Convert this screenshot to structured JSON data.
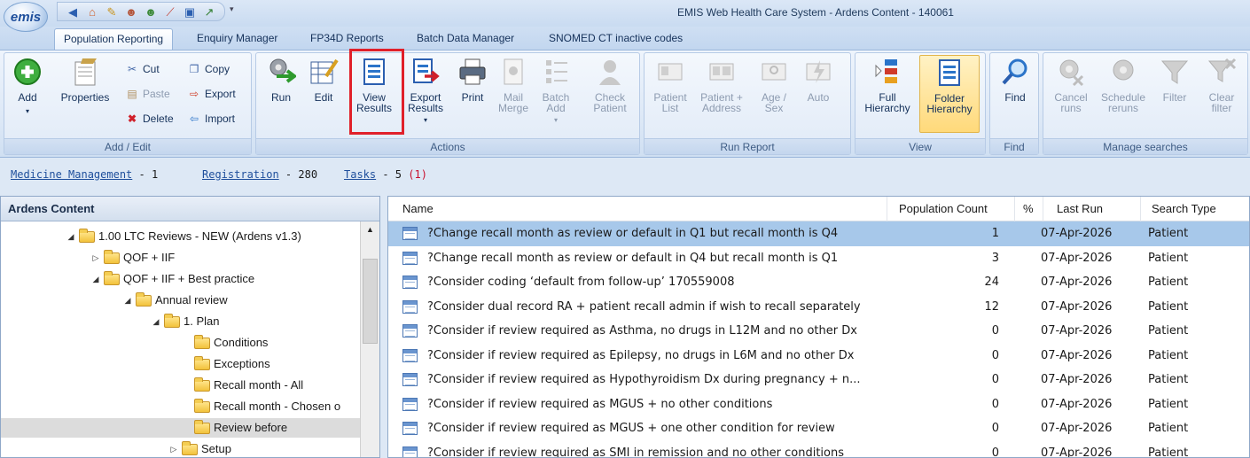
{
  "app": {
    "logo_text": "emis",
    "window_title": "EMIS Web Health Care System - Ardens Content - 140061",
    "quick_access_icons": [
      "back-icon",
      "home-icon",
      "pencil-icon",
      "users-icon",
      "user-group-icon",
      "chart-icon",
      "window-icon",
      "graph-icon"
    ]
  },
  "tabs": [
    "Population Reporting",
    "Enquiry Manager",
    "FP34D Reports",
    "Batch Data Manager",
    "SNOMED CT inactive codes"
  ],
  "ribbon": {
    "add_edit": {
      "label": "Add / Edit",
      "add": "Add",
      "properties": "Properties",
      "cut": "Cut",
      "copy": "Copy",
      "paste": "Paste",
      "export": "Export",
      "delete": "Delete",
      "import": "Import"
    },
    "actions": {
      "label": "Actions",
      "run": "Run",
      "edit": "Edit",
      "view_results": "View\nResults",
      "export_results": "Export\nResults",
      "print": "Print",
      "mail_merge": "Mail\nMerge",
      "batch_add": "Batch\nAdd",
      "check_patient": "Check\nPatient"
    },
    "run_report": {
      "label": "Run Report",
      "patient_list": "Patient\nList",
      "patient_address": "Patient +\nAddress",
      "age_sex": "Age /\nSex",
      "auto": "Auto"
    },
    "view": {
      "label": "View",
      "full_hierarchy": "Full\nHierarchy",
      "folder_hierarchy": "Folder\nHierarchy"
    },
    "find": {
      "label": "Find",
      "find": "Find"
    },
    "manage": {
      "label": "Manage searches",
      "cancel_runs": "Cancel\nruns",
      "schedule_reruns": "Schedule\nreruns",
      "filter": "Filter",
      "clear_filter": "Clear\nfilter"
    }
  },
  "shortcuts": {
    "medicine_link": "Medicine Management",
    "medicine_count": " - 1",
    "registration_link": "Registration",
    "registration_count": " - 280",
    "tasks_link": "Tasks",
    "tasks_count": " - 5 ",
    "tasks_alert": "(1)"
  },
  "tree": {
    "title": "Ardens Content",
    "nodes": [
      {
        "label": "1.00 LTC Reviews - NEW (Ardens v1.3)",
        "expander": "◢"
      },
      {
        "label": "QOF + IIF",
        "expander": "▷"
      },
      {
        "label": "QOF + IIF + Best practice",
        "expander": "◢"
      },
      {
        "label": "Annual review",
        "expander": "◢"
      },
      {
        "label": "1. Plan",
        "expander": "◢"
      },
      {
        "label": "Conditions",
        "expander": ""
      },
      {
        "label": "Exceptions",
        "expander": ""
      },
      {
        "label": "Recall month - All",
        "expander": ""
      },
      {
        "label": "Recall month - Chosen o",
        "expander": ""
      },
      {
        "label": "Review before",
        "expander": ""
      },
      {
        "label": "Setup",
        "expander": "▷"
      }
    ]
  },
  "grid": {
    "headers": {
      "name": "Name",
      "count": "Population Count",
      "pct": "%",
      "last_run": "Last Run",
      "type": "Search Type"
    },
    "rows": [
      {
        "name": "?Change recall month as review or default in Q1 but recall month is Q4",
        "count": "1",
        "last_run": "07-Apr-2026",
        "type": "Patient"
      },
      {
        "name": "?Change recall month as review or default in Q4 but recall month is Q1",
        "count": "3",
        "last_run": "07-Apr-2026",
        "type": "Patient"
      },
      {
        "name": "?Consider coding ‘default from follow-up’ 170559008",
        "count": "24",
        "last_run": "07-Apr-2026",
        "type": "Patient"
      },
      {
        "name": "?Consider dual record RA + patient recall admin if wish to recall separately",
        "count": "12",
        "last_run": "07-Apr-2026",
        "type": "Patient"
      },
      {
        "name": "?Consider if review required as Asthma, no drugs in L12M and no other Dx",
        "count": "0",
        "last_run": "07-Apr-2026",
        "type": "Patient"
      },
      {
        "name": "?Consider if review required as Epilepsy, no drugs in L6M and no other Dx",
        "count": "0",
        "last_run": "07-Apr-2026",
        "type": "Patient"
      },
      {
        "name": "?Consider if review required as Hypothyroidism Dx during pregnancy + n...",
        "count": "0",
        "last_run": "07-Apr-2026",
        "type": "Patient"
      },
      {
        "name": "?Consider if review required as MGUS + no other conditions",
        "count": "0",
        "last_run": "07-Apr-2026",
        "type": "Patient"
      },
      {
        "name": "?Consider if review required as MGUS + one other condition for review",
        "count": "0",
        "last_run": "07-Apr-2026",
        "type": "Patient"
      },
      {
        "name": "?Consider if review required as SMI in remission and no other conditions",
        "count": "0",
        "last_run": "07-Apr-2026",
        "type": "Patient"
      }
    ]
  }
}
